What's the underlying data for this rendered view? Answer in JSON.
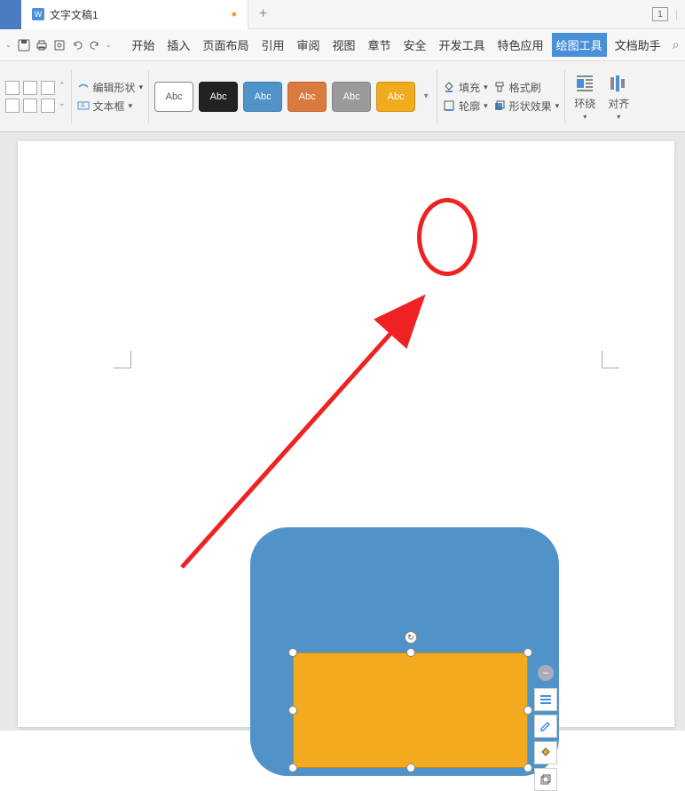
{
  "title": {
    "tab_name": "文字文稿1",
    "doc_count": "1"
  },
  "menu": {
    "tabs": [
      "开始",
      "插入",
      "页面布局",
      "引用",
      "审阅",
      "视图",
      "章节",
      "安全",
      "开发工具",
      "特色应用",
      "绘图工具",
      "文档助手"
    ],
    "active_index": 10
  },
  "ribbon": {
    "edit_shape": "编辑形状",
    "textbox": "文本框",
    "swatch_label": "Abc",
    "fill": "填充",
    "outline": "轮廓",
    "format_painter": "格式刷",
    "shape_effects": "形状效果",
    "wrap": "环绕",
    "align": "对齐"
  },
  "icons": {
    "chevron": "▾",
    "plus": "+",
    "separator": "|"
  }
}
